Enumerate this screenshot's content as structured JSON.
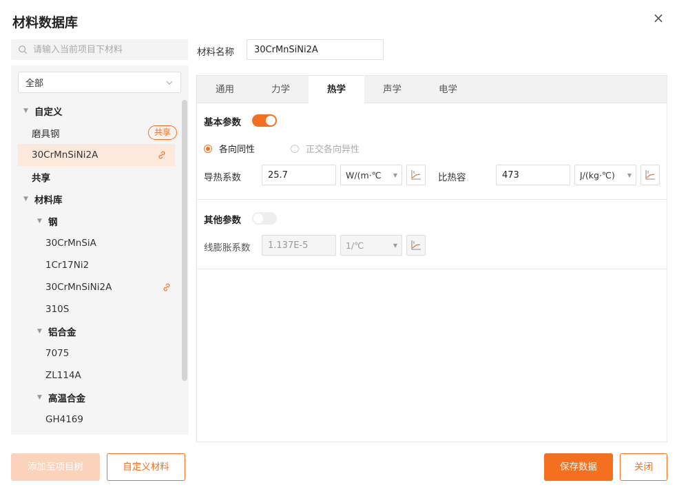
{
  "dialog": {
    "title": "材料数据库",
    "close_glyph": "×"
  },
  "search": {
    "placeholder": "请输入当前项目下材料",
    "value": ""
  },
  "filter": {
    "selected": "全部"
  },
  "tree": [
    {
      "label": "自定义",
      "type": "group",
      "level": 0,
      "expanded": true
    },
    {
      "label": "磨具钢",
      "type": "item",
      "level": 1,
      "badge": "共享"
    },
    {
      "label": "30CrMnSiNi2A",
      "type": "item",
      "level": 1,
      "selected": true,
      "linked": true
    },
    {
      "label": "共享",
      "type": "group",
      "level": 0,
      "expanded": false
    },
    {
      "label": "材料库",
      "type": "group",
      "level": 0,
      "expanded": true
    },
    {
      "label": "钢",
      "type": "group",
      "level": 1,
      "expanded": true
    },
    {
      "label": "30CrMnSiA",
      "type": "item",
      "level": 2
    },
    {
      "label": "1Cr17Ni2",
      "type": "item",
      "level": 2
    },
    {
      "label": "30CrMnSiNi2A",
      "type": "item",
      "level": 2,
      "linked": true
    },
    {
      "label": "310S",
      "type": "item",
      "level": 2
    },
    {
      "label": "铝合金",
      "type": "group",
      "level": 1,
      "expanded": true
    },
    {
      "label": "7075",
      "type": "item",
      "level": 2
    },
    {
      "label": "ZL114A",
      "type": "item",
      "level": 2
    },
    {
      "label": "高温合金",
      "type": "group",
      "level": 1,
      "expanded": true
    },
    {
      "label": "GH4169",
      "type": "item",
      "level": 2
    }
  ],
  "material": {
    "name_label": "材料名称",
    "name_value": "30CrMnSiNi2A"
  },
  "tabs": [
    {
      "label": "通用",
      "active": false
    },
    {
      "label": "力学",
      "active": false
    },
    {
      "label": "热学",
      "active": true
    },
    {
      "label": "声学",
      "active": false
    },
    {
      "label": "电学",
      "active": false
    }
  ],
  "basic": {
    "title": "基本参数",
    "enabled": true,
    "radio_isotropic": "各向同性",
    "radio_orthotropic": "正交各向异性",
    "conductivity_label": "导热系数",
    "conductivity_value": "25.7",
    "conductivity_unit": "W/(m·℃",
    "heat_capacity_label": "比热容",
    "heat_capacity_value": "473",
    "heat_capacity_unit": "J/(kg·℃)"
  },
  "other": {
    "title": "其他参数",
    "enabled": false,
    "expansion_label": "线膨胀系数",
    "expansion_value": "1.137E-5",
    "expansion_unit": "1/℃"
  },
  "footer": {
    "add_label": "添加至项目树",
    "custom_label": "自定义材料",
    "save_label": "保存数据",
    "close_label": "关闭"
  },
  "colors": {
    "accent": "#f37021",
    "accent_light": "#fbd2bb",
    "selected_bg": "#fde9dc"
  }
}
